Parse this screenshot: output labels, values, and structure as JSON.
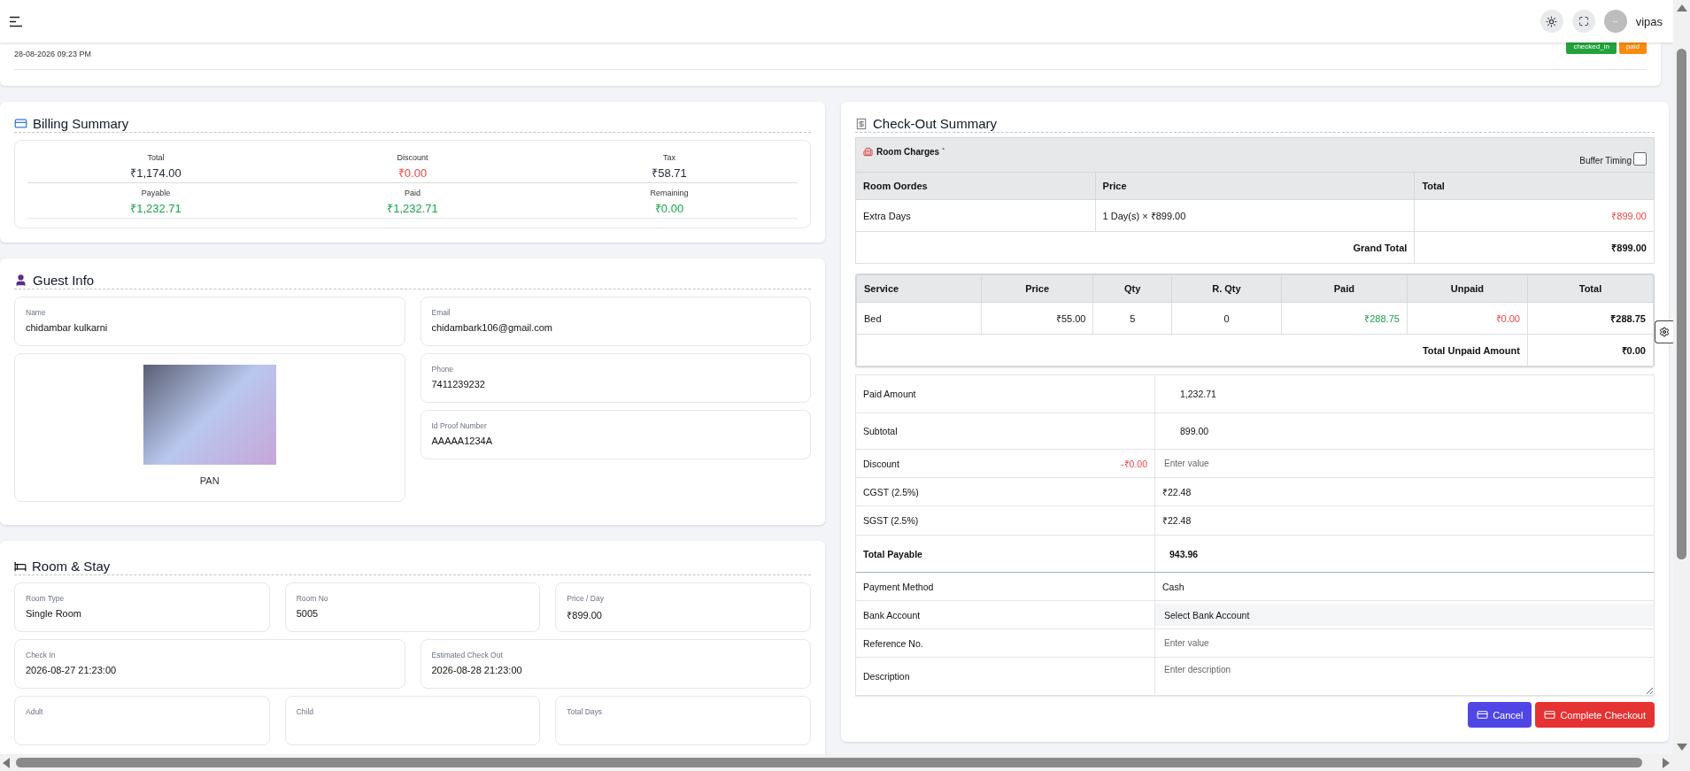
{
  "topbar": {
    "user": "vipas",
    "avatar_text": "--"
  },
  "header": {
    "date": "28-08-2026 09:23 PM",
    "badges": [
      {
        "label": "checked_in",
        "color": "#22a33a"
      },
      {
        "label": "paid",
        "color": "#f98a0c"
      }
    ]
  },
  "billing": {
    "title": "Billing Summary",
    "items": [
      {
        "label": "Total",
        "value": "₹1,174.00",
        "color": "#1f2937"
      },
      {
        "label": "Discount",
        "value": "₹0.00",
        "color": "#ef4444"
      },
      {
        "label": "Tax",
        "value": "₹58.71",
        "color": "#1f2937"
      },
      {
        "label": "Payable",
        "value": "₹1,232.71",
        "color": "#16a34a"
      },
      {
        "label": "Paid",
        "value": "₹1,232.71",
        "color": "#16a34a"
      },
      {
        "label": "Remaining",
        "value": "₹0.00",
        "color": "#16a34a"
      }
    ]
  },
  "guest": {
    "title": "Guest Info",
    "name": {
      "label": "Name",
      "value": "chidambar kulkarni"
    },
    "id_caption": "PAN",
    "contacts": [
      {
        "label": "Email",
        "value": "chidambark106@gmail.com"
      },
      {
        "label": "Phone",
        "value": "7411239232"
      },
      {
        "label": "Id Proof Number",
        "value": "AAAAA1234A"
      }
    ]
  },
  "room_stay": {
    "title": "Room & Stay",
    "rows": [
      [
        {
          "label": "Room Type",
          "value": "Single Room"
        },
        {
          "label": "Room No",
          "value": "5005"
        },
        {
          "label": "Price / Day",
          "value": "₹899.00"
        }
      ],
      [
        {
          "label": "Check In",
          "value": "2026-08-27 21:23:00"
        },
        {
          "label": "Estimated Check Out",
          "value": "2026-08-28 21:23:00"
        }
      ],
      [
        {
          "label": "Adult"
        },
        {
          "label": "Child"
        },
        {
          "label": "Total Days"
        }
      ]
    ]
  },
  "checkout": {
    "title": "Check-Out Summary",
    "room_charges": {
      "title": "Room Charges `",
      "buffer_label": "Buffer Timing",
      "buffer_checked": false,
      "columns": [
        "Room Oordes",
        "Price",
        "Total"
      ],
      "rows": [
        {
          "cells": [
            {
              "text": "Extra Days"
            },
            {
              "text": "1 Day(s) × ₹899.00"
            },
            {
              "text": "₹899.00",
              "color": "#ef4444"
            }
          ]
        }
      ],
      "total_label": "Grand Total",
      "total_value": "₹899.00"
    },
    "services": {
      "columns": [
        "Service",
        "Price",
        "Qty",
        "R. Qty",
        "Paid",
        "Unpaid",
        "Total"
      ],
      "rows": [
        {
          "cells": [
            {
              "text": "Bed"
            },
            {
              "text": "₹55.00"
            },
            {
              "text": "5"
            },
            {
              "text": "0"
            },
            {
              "text": "₹288.75",
              "color": "#16a34a"
            },
            {
              "text": "₹0.00",
              "color": "#ef4444"
            },
            {
              "text": "₹288.75"
            }
          ]
        }
      ],
      "total_label": "Total Unpaid Amount",
      "total_value": "₹0.00"
    },
    "form": [
      {
        "kind": "value",
        "label": "Paid Amount",
        "value": "1,232.71"
      },
      {
        "kind": "value",
        "label": "Subtotal",
        "value": "899.00"
      },
      {
        "kind": "input",
        "label": "Discount",
        "note": "-₹0.00",
        "placeholder": "Enter value"
      },
      {
        "kind": "plain",
        "label": "CGST (2.5%)",
        "value": "₹22.48"
      },
      {
        "kind": "plain",
        "label": "SGST (2.5%)",
        "value": "₹22.48"
      },
      {
        "kind": "total",
        "label": "Total Payable",
        "value": "943.96"
      },
      {
        "kind": "plain",
        "label": "Payment Method",
        "value": "Cash"
      },
      {
        "kind": "select",
        "label": "Bank Account",
        "value": "Select Bank Account"
      },
      {
        "kind": "input",
        "label": "Reference No.",
        "placeholder": "Enter value"
      },
      {
        "kind": "textarea",
        "label": "Description",
        "placeholder": "Enter description"
      }
    ],
    "buttons": [
      {
        "label": "Cancel",
        "kind": "secondary"
      },
      {
        "label": "Complete Checkout",
        "kind": "primary"
      }
    ]
  }
}
